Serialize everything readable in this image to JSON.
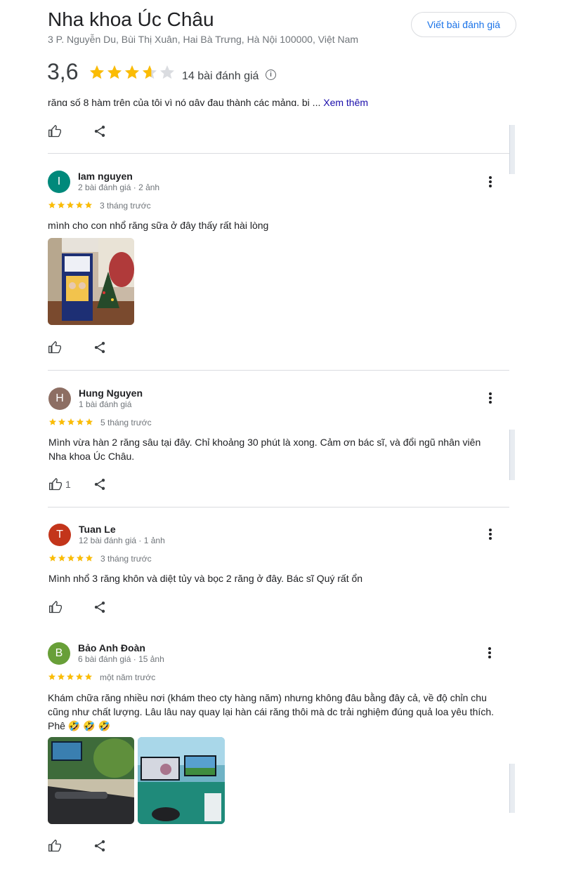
{
  "place": {
    "title": "Nha khoa Úc Châu",
    "address": "3 P. Nguyễn Du, Bùi Thị Xuân, Hai Bà Trưng, Hà Nội 100000, Việt Nam",
    "write_review_label": "Viết bài đánh giá",
    "rating_value": "3,6",
    "rating_stars": 3.6,
    "review_count_label": "14 bài đánh giá",
    "info_icon": "info-icon"
  },
  "previous_review": {
    "clipped_text": "răng số 8 hàm trên của tôi vì nó gây đau thành các mảng, bị ...",
    "more_label": "Xem thêm"
  },
  "reviews": [
    {
      "avatar_letter": "I",
      "avatar_color": "#00897b",
      "name": "Iam nguyen",
      "meta": "2 bài đánh giá · 2 ảnh",
      "stars": 5,
      "time": "3 tháng trước",
      "text": "mình cho con nhổ răng sữa ở đây thấy rất hài lòng",
      "like_count": ""
    },
    {
      "avatar_letter": "H",
      "avatar_color": "#8d6e63",
      "name": "Hung Nguyen",
      "meta": "1 bài đánh giá",
      "stars": 5,
      "time": "5 tháng trước",
      "text": "Mình vừa hàn 2 răng sâu tại đây. Chỉ khoảng 30 phút là xong. Cảm ơn bác sĩ, và đổi ngũ nhân viên Nha khoa Úc Châu.",
      "like_count": "1"
    },
    {
      "avatar_letter": "T",
      "avatar_color": "#c3351b",
      "name": "Tuan Le",
      "meta": "12 bài đánh giá · 1 ảnh",
      "stars": 5,
      "time": "3 tháng trước",
      "text": "Mình nhổ 3 răng khôn và diệt tủy và bọc 2 răng ở đây. Bác sĩ Quý rất ổn",
      "like_count": ""
    },
    {
      "avatar_letter": "B",
      "avatar_color": "#689f38",
      "name": "Bảo Anh Đoàn",
      "meta": "6 bài đánh giá · 15 ảnh",
      "stars": 5,
      "time": "một năm trước",
      "text_line1": "Khám chữa răng nhiều nơi (khám theo cty hàng năm) nhưng không đâu bằng đây cả, về độ chỉn chu",
      "text_line2": "cũng như chất lượng. Lâu lâu nay quay lại hàn cái răng thôi mà dc trải nghiệm đúng quả loa yêu thích.",
      "text_line3": "Phê 🤣 🤣 🤣",
      "like_count": ""
    }
  ],
  "colors": {
    "star": "#fbbc04",
    "star_empty": "#dadce0",
    "accent": "#1a73e8"
  }
}
